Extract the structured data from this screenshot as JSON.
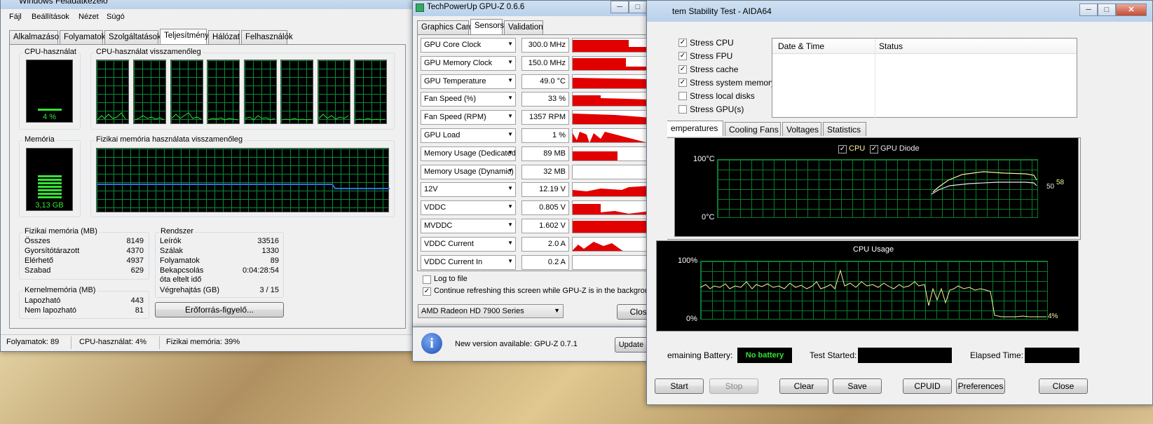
{
  "task_manager": {
    "title": "Windows Feladatkezelő",
    "menu": [
      "Fájl",
      "Beállítások",
      "Nézet",
      "Súgó"
    ],
    "tabs": [
      "Alkalmazások",
      "Folyamatok",
      "Szolgáltatások",
      "Teljesítmény",
      "Hálózat",
      "Felhasználók"
    ],
    "cpu_usage_label": "CPU-használat",
    "cpu_usage_value": "4 %",
    "cpu_history_label": "CPU-használat visszamenőleg",
    "memory_label": "Memória",
    "memory_value": "3,13 GB",
    "phys_mem_history_label": "Fizikai memória használata visszamenőleg",
    "phys_mem_group": "Fizikai memória (MB)",
    "phys_mem_rows": [
      {
        "k": "Összes",
        "v": "8149"
      },
      {
        "k": "Gyorsítótárazott",
        "v": "4370"
      },
      {
        "k": "Elérhető",
        "v": "4937"
      },
      {
        "k": "Szabad",
        "v": "629"
      }
    ],
    "kernel_group": "Kernelmemória (MB)",
    "kernel_rows": [
      {
        "k": "Lapozható",
        "v": "443"
      },
      {
        "k": "Nem lapozható",
        "v": "81"
      }
    ],
    "system_group": "Rendszer",
    "system_rows": [
      {
        "k": "Leírók",
        "v": "33516"
      },
      {
        "k": "Szálak",
        "v": "1330"
      },
      {
        "k": "Folyamatok",
        "v": "89"
      },
      {
        "k": "Bekapcsolás óta eltelt idő",
        "v": "0:04:28:54"
      },
      {
        "k": "Végrehajtás (GB)",
        "v": "3 / 15"
      }
    ],
    "resource_monitor_button": "Erőforrás-figyelő...",
    "status": {
      "processes": "Folyamatok: 89",
      "cpu": "CPU-használat: 4%",
      "memory": "Fizikai memória: 39%"
    }
  },
  "gpuz": {
    "title": "TechPowerUp GPU-Z 0.6.6",
    "tabs": [
      "Graphics Card",
      "Sensors",
      "Validation"
    ],
    "sensors": [
      {
        "name": "GPU Core Clock",
        "value": "300.0 MHz"
      },
      {
        "name": "GPU Memory Clock",
        "value": "150.0 MHz"
      },
      {
        "name": "GPU Temperature",
        "value": "49.0 °C"
      },
      {
        "name": "Fan Speed (%)",
        "value": "33 %"
      },
      {
        "name": "Fan Speed (RPM)",
        "value": "1357 RPM"
      },
      {
        "name": "GPU Load",
        "value": "1 %"
      },
      {
        "name": "Memory Usage (Dedicated)",
        "value": "89 MB"
      },
      {
        "name": "Memory Usage (Dynamic)",
        "value": "32 MB"
      },
      {
        "name": "12V",
        "value": "12.19 V"
      },
      {
        "name": "VDDC",
        "value": "0.805 V"
      },
      {
        "name": "MVDDC",
        "value": "1.602 V"
      },
      {
        "name": "VDDC Current",
        "value": "2.0 A"
      },
      {
        "name": "VDDC Current In",
        "value": "0.2 A"
      }
    ],
    "log_to_file": "Log to file",
    "continue_refresh": "Continue refreshing this screen while GPU-Z is in the background",
    "gpu_select": "AMD Radeon HD 7900 Series",
    "close_button": "Close",
    "update_msg": "New version available: GPU-Z 0.7.1",
    "update_button": "Update Now"
  },
  "aida": {
    "title": "tem Stability Test - AIDA64",
    "stress": [
      {
        "label": "Stress CPU",
        "checked": true
      },
      {
        "label": "Stress FPU",
        "checked": true
      },
      {
        "label": "Stress cache",
        "checked": true
      },
      {
        "label": "Stress system memory",
        "checked": true
      },
      {
        "label": "Stress local disks",
        "checked": false
      },
      {
        "label": "Stress GPU(s)",
        "checked": false
      }
    ],
    "table_headers": [
      "Date & Time",
      "Status"
    ],
    "tabs": [
      "emperatures",
      "Cooling Fans",
      "Voltages",
      "Statistics"
    ],
    "temp_legend": [
      "CPU",
      "GPU Diode"
    ],
    "temp_top": "100°C",
    "temp_bottom": "0°C",
    "temp_value_gpu": "50",
    "temp_value_cpu": "58",
    "usage_title": "CPU Usage",
    "usage_top": "100%",
    "usage_bottom": "0%",
    "usage_value": "4%",
    "remaining_battery_label": "emaining Battery:",
    "battery_value": "No battery",
    "test_started_label": "Test Started:",
    "elapsed_label": "Elapsed Time:",
    "buttons": [
      "Start",
      "Stop",
      "Clear",
      "Save",
      "CPUID",
      "Preferences",
      "Close"
    ]
  }
}
